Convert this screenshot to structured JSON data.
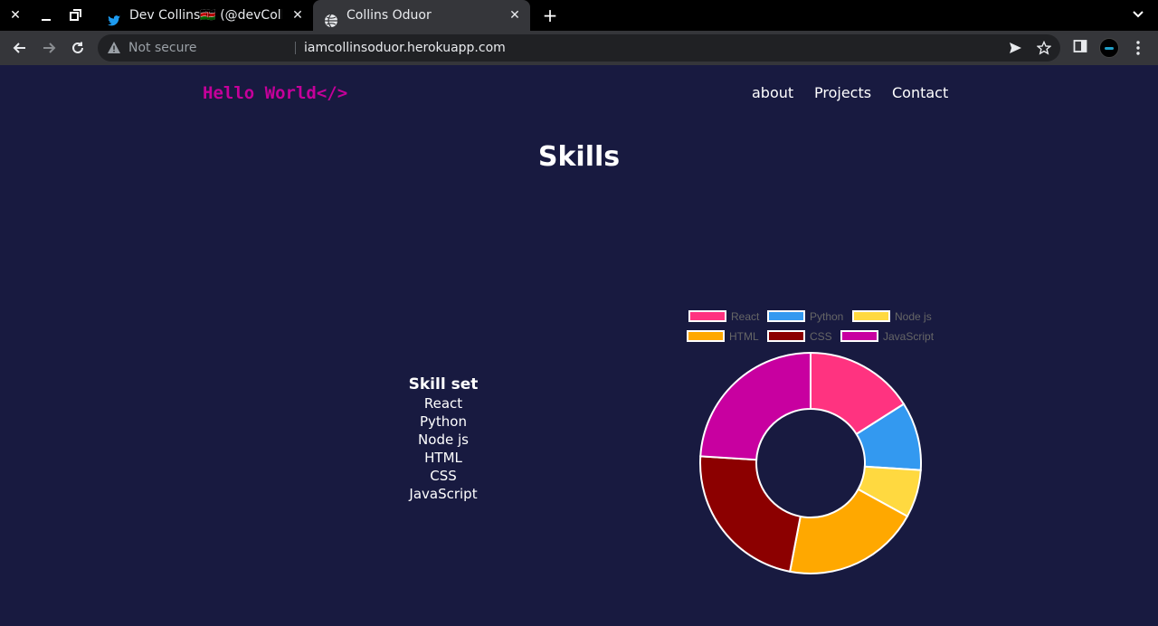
{
  "browser": {
    "tabs": [
      {
        "title": "Dev Collins🇰🇪 (@devCollins",
        "active": false,
        "icon": "twitter-bird-icon"
      },
      {
        "title": "Collins Oduor",
        "active": true,
        "icon": "globe-icon"
      }
    ],
    "security_label": "Not secure",
    "url": "iamcollinsoduor.herokuapp.com"
  },
  "site": {
    "logo": "Hello World</>",
    "nav": [
      "about",
      "Projects",
      "Contact"
    ]
  },
  "skills": {
    "title": "Skills",
    "list_heading": "Skill set",
    "list": [
      "React",
      "Python",
      "Node js",
      "HTML",
      "CSS",
      "JavaScript"
    ]
  },
  "chart_data": {
    "type": "pie",
    "variant": "doughnut",
    "categories": [
      "React",
      "Python",
      "Node js",
      "HTML",
      "CSS",
      "JavaScript"
    ],
    "values": [
      16,
      10,
      7,
      20,
      23,
      24
    ],
    "colors": [
      "#ff3380",
      "#3399f0",
      "#ffd940",
      "#ffa800",
      "#8c0000",
      "#c800a0"
    ],
    "legend_position": "top"
  },
  "colors": {
    "background": "#181a40",
    "logo": "#c5009a"
  }
}
